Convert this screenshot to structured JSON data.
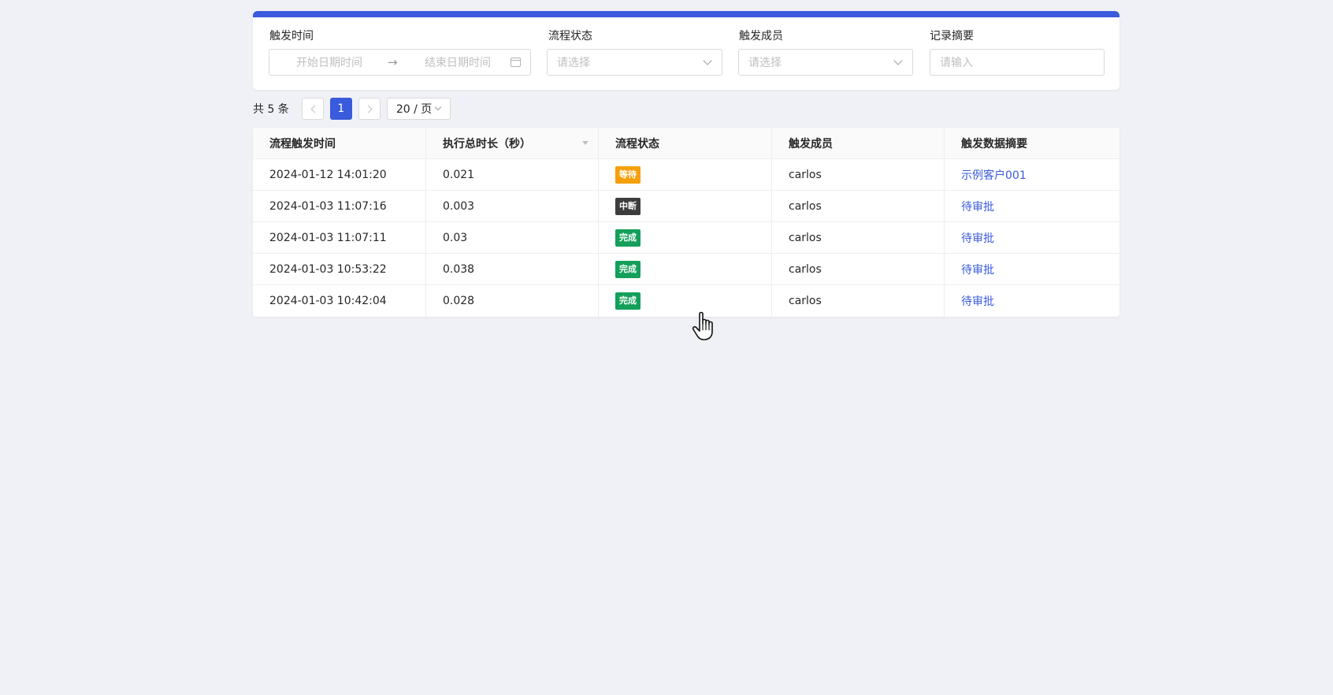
{
  "filters": {
    "time": {
      "label": "触发时间",
      "start_placeholder": "开始日期时间",
      "separator": "→",
      "end_placeholder": "结束日期时间"
    },
    "status": {
      "label": "流程状态",
      "placeholder": "请选择"
    },
    "member": {
      "label": "触发成员",
      "placeholder": "请选择"
    },
    "summary": {
      "label": "记录摘要",
      "placeholder": "请输入"
    }
  },
  "pagination": {
    "total": "共 5 条",
    "current_page": "1",
    "page_size": "20 / 页"
  },
  "table": {
    "headers": [
      "流程触发时间",
      "执行总时长（秒）",
      "流程状态",
      "触发成员",
      "触发数据摘要"
    ],
    "rows": [
      {
        "time": "2024-01-12 14:01:20",
        "duration": "0.021",
        "status": "等待",
        "member": "carlos",
        "summary": "示例客户001"
      },
      {
        "time": "2024-01-03 11:07:16",
        "duration": "0.003",
        "status": "中断",
        "member": "carlos",
        "summary": "待审批"
      },
      {
        "time": "2024-01-03 11:07:11",
        "duration": "0.03",
        "status": "完成",
        "member": "carlos",
        "summary": "待审批"
      },
      {
        "time": "2024-01-03 10:53:22",
        "duration": "0.038",
        "status": "完成",
        "member": "carlos",
        "summary": "待审批"
      },
      {
        "time": "2024-01-03 10:42:04",
        "duration": "0.028",
        "status": "完成",
        "member": "carlos",
        "summary": "待审批"
      }
    ]
  },
  "colors": {
    "accent": "#3a5bdc",
    "status_waiting": "#f5a00b",
    "status_interrupted": "#3d3d3d",
    "status_done": "#14a05a"
  }
}
